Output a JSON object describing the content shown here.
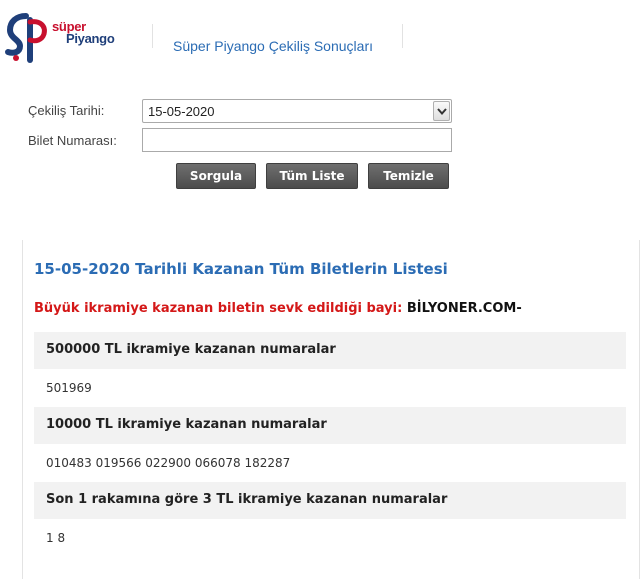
{
  "logo": {
    "line1": "süper",
    "line2": "Piyango"
  },
  "header": {
    "title": "Süper Piyango Çekiliş Sonuçları"
  },
  "form": {
    "date_label": "Çekiliş Tarihi:",
    "date_value": "15-05-2020",
    "ticket_label": "Bilet Numarası:",
    "ticket_value": "",
    "buttons": {
      "query": "Sorgula",
      "full_list": "Tüm Liste",
      "clear": "Temizle"
    }
  },
  "results": {
    "title": "15-05-2020 Tarihli Kazanan Tüm Biletlerin Listesi",
    "bayi_label": "Büyük ikramiye kazanan biletin sevk edildiği bayi:",
    "bayi_name": "BİLYONER.COM-",
    "sections": [
      {
        "heading": "500000 TL ikramiye kazanan numaralar",
        "numbers": "501969"
      },
      {
        "heading": "10000 TL ikramiye kazanan numaralar",
        "numbers": "010483 019566 022900 066078 182287"
      },
      {
        "heading": "Son 1 rakamına göre 3 TL ikramiye kazanan numaralar",
        "numbers": "1 8"
      }
    ]
  },
  "colors": {
    "accent_blue": "#2b6cb4",
    "bayi_red": "#d41818",
    "button_gray": "#5a5a5a",
    "logo_red": "#c8102e",
    "logo_navy": "#1f3f7a"
  },
  "icons": {
    "logo": "super-piyango-logo-icon",
    "dropdown": "chevron-down-icon"
  }
}
